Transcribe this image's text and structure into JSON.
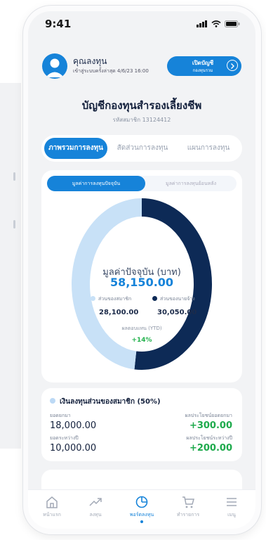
{
  "status": {
    "time": "9:41"
  },
  "user": {
    "name": "คุณลงทุน",
    "last_login": "เข้าสู่ระบบครั้งล่าสุด 4/6/23 16:00"
  },
  "open_account": {
    "line1": "เปิดบัญชี",
    "line2": "กองทุนรวม"
  },
  "account": {
    "title": "บัญชีกองทุนสำรองเลี้ยงชีพ",
    "member_id": "รหัสสมาชิก 13124412"
  },
  "tabs": [
    {
      "label": "ภาพรวมการลงทุน",
      "active": true
    },
    {
      "label": "สัดส่วนการลงทุน",
      "active": false
    },
    {
      "label": "แผนการลงทุน",
      "active": false
    }
  ],
  "subtabs": [
    {
      "label": "มูลค่าการลงทุนปัจจุบัน",
      "active": true
    },
    {
      "label": "มูลค่าการลงทุนย้อนหลัง",
      "active": false
    }
  ],
  "chart": {
    "center_label": "มูลค่าปัจจุบัน (บาท)",
    "total": "58,150.00",
    "legend": [
      {
        "label": "ส่วนของสมาชิก",
        "value": "28,100.00",
        "amount": 28100,
        "color": "#c8e1f7"
      },
      {
        "label": "ส่วนของนายจ้าง",
        "value": "30,050.00",
        "amount": 30050,
        "color": "#0d2a56"
      }
    ],
    "ytd_label": "ผลตอบแทน (YTD)",
    "ytd_value": "+14%"
  },
  "member": {
    "title": "เงินลงทุนส่วนของสมาชิก (50%)",
    "dot_color": "#bcd9f5",
    "principal_label": "ยอดยกมา",
    "principal_value": "18,000.00",
    "gain_label": "ผลประโยชน์ยอดยกมา",
    "gain_value": "+300.00",
    "contrib_label": "ยอดระหว่างปี",
    "contrib_value": "10,000.00",
    "contrib_gain_label": "ผลประโยชน์ระหว่างปี",
    "contrib_gain_value": "+200.00"
  },
  "nav": [
    {
      "label": "หน้าแรก",
      "icon": "home-icon",
      "active": false
    },
    {
      "label": "ลงทุน",
      "icon": "trend-icon",
      "active": false
    },
    {
      "label": "พอร์ตลงทุน",
      "icon": "pie-icon",
      "active": true
    },
    {
      "label": "ทำรายการ",
      "icon": "cart-icon",
      "active": false
    },
    {
      "label": "เมนู",
      "icon": "menu-icon",
      "active": false
    }
  ],
  "colors": {
    "accent": "#1683d9",
    "navy": "#0d2a56",
    "light": "#c8e1f7",
    "positive": "#1eaa4c"
  }
}
